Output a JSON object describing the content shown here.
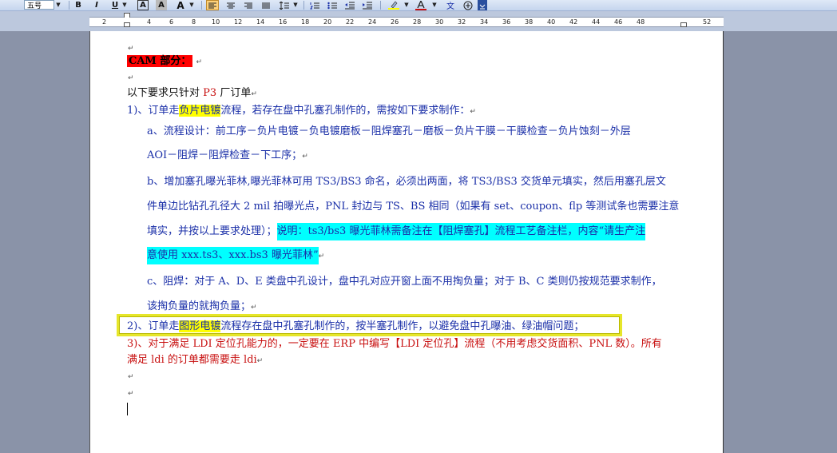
{
  "toolbar": {
    "font_size": "五号",
    "bold_label": "B",
    "italic_label": "I",
    "underline_label": "U",
    "char_border_label": "A",
    "char_shading_label": "A",
    "char_scale_label": "A",
    "phonetic_label": "文"
  },
  "ruler": {
    "numbers": [
      "2",
      "2",
      "4",
      "6",
      "8",
      "10",
      "12",
      "14",
      "16",
      "18",
      "20",
      "22",
      "24",
      "26",
      "28",
      "30",
      "32",
      "34",
      "36",
      "38",
      "40",
      "42",
      "44",
      "46",
      "48",
      "52"
    ]
  },
  "document": {
    "heading": "CAM 部分：",
    "intro_a": "以下要求只针对",
    "intro_p3": "P3",
    "intro_b": "厂订单",
    "item1_a": "1)、订单走",
    "item1_hl": "负片电镀",
    "item1_b": "流程，若存在盘中孔塞孔制作的，需按如下要求制作：",
    "a_line1": "a、流程设计：前工序－负片电镀－负电镀磨板－阻焊塞孔－磨板－负片干膜－干膜检查－负片蚀刻－外层",
    "a_line2": "AOI－阻焊－阻焊检查－下工序；",
    "b_line1": "b、增加塞孔曝光菲林,曝光菲林可用 TS3/BS3 命名，必须出两面，将 TS3/BS3 交货单元填实，然后用塞孔层文",
    "b_line2": "件单边比钻孔孔径大 2 mil 拍曝光点，PNL 封边与 TS、BS 相同（如果有 set、coupon、flp 等测试条也需要注意",
    "b_line3_a": "填实，并按以上要求处理）；",
    "b_line3_hl": "说明：ts3/bs3 曝光菲林需备注在【阻焊塞孔】流程工艺备注栏，内容“请生产注",
    "b_line4_hl": "意使用 xxx.ts3、xxx.bs3 曝光菲林”",
    "c_line1": "c、阻焊：对于 A、D、E 类盘中孔设计，盘中孔对应开窗上面不用掏负量；对于 B、C 类则仍按规范要求制作，",
    "c_line2": "该掏负量的就掏负量；",
    "item2_a": "2)、订单走",
    "item2_hl": "图形电镀",
    "item2_b": "流程存在盘中孔塞孔制作的，按半塞孔制作，以避免盘中孔曝油、绿油帽问题；",
    "item3_line1": "3)、对于满足 LDI 定位孔能力的，一定要在 ERP 中编写【LDI 定位孔】流程（不用考虑交货面积、PNL 数）。所有",
    "item3_line2": "满足 ldi 的订单都需要走 ldi",
    "para_mark": "↵"
  },
  "colors": {
    "red_text": "#c81010",
    "blue_text": "#1a2fa8",
    "highlight_yellow": "#ffff00",
    "highlight_cyan": "#00ffff",
    "box_yellow": "#e6e62a"
  }
}
